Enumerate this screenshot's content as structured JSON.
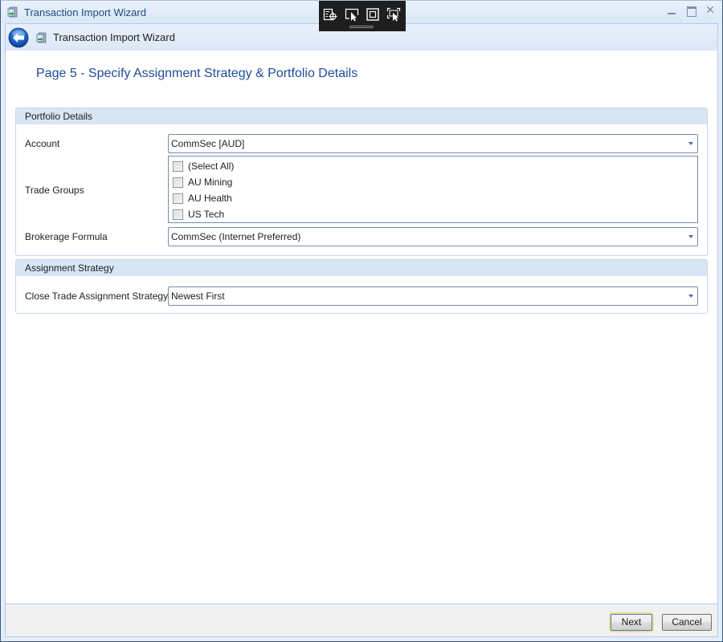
{
  "window": {
    "title": "Transaction Import Wizard",
    "icon": "wizard-app-icon",
    "controls": {
      "minimize": "minimize-icon",
      "maximize": "maximize-icon",
      "close": "close-icon",
      "close_glyph": "✕"
    }
  },
  "debug_toolbar": {
    "tools": [
      "select-element-icon",
      "select-pointer-icon",
      "layout-adorner-icon",
      "track-focus-icon"
    ]
  },
  "nav": {
    "back": "back-arrow-icon",
    "title": "Transaction Import Wizard"
  },
  "page": {
    "title": "Page 5 - Specify Assignment Strategy & Portfolio Details"
  },
  "portfolio_details": {
    "header": "Portfolio Details",
    "account": {
      "label": "Account",
      "value": "CommSec [AUD]"
    },
    "trade_groups": {
      "label": "Trade Groups",
      "items": [
        {
          "label": "(Select All)",
          "checked": false
        },
        {
          "label": "AU Mining",
          "checked": false
        },
        {
          "label": "AU Health",
          "checked": false
        },
        {
          "label": "US Tech",
          "checked": false
        }
      ]
    },
    "brokerage_formula": {
      "label": "Brokerage Formula",
      "value": "CommSec (Internet Preferred)"
    }
  },
  "assignment_strategy": {
    "header": "Assignment Strategy",
    "close_trade": {
      "label": "Close Trade Assignment Strategy",
      "value": "Newest First"
    }
  },
  "footer": {
    "next_label": "Next",
    "cancel_label": "Cancel"
  },
  "colors": {
    "accent_title": "#1e4c9b",
    "group_header_bg": "#d8e5f4",
    "window_frame": "#e4eefb",
    "default_button_glow": "#f5dc98"
  }
}
